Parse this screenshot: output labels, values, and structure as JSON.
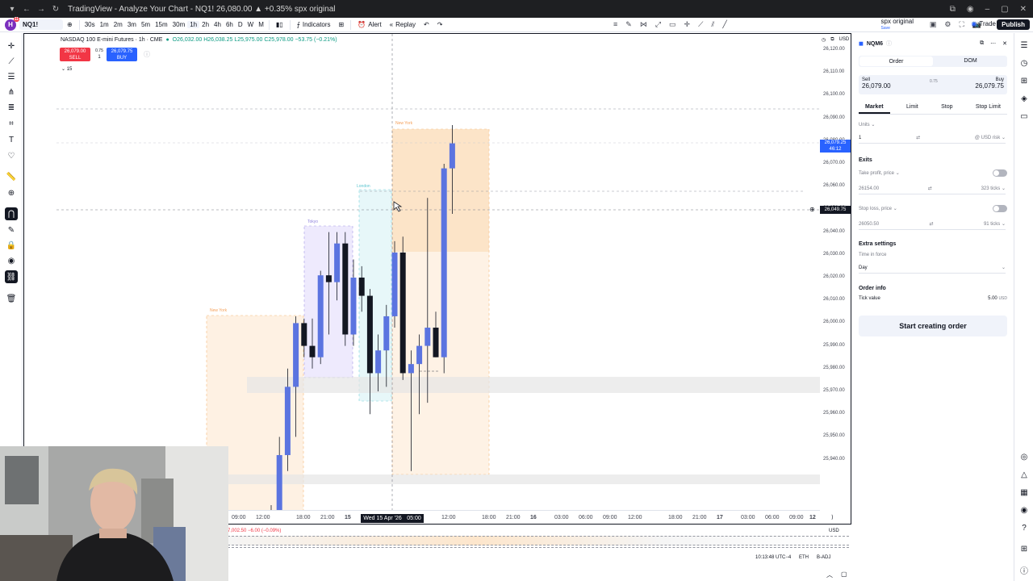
{
  "browser": {
    "tab_title": "TradingView - Analyze Your Chart - NQ1! 26,080.00 ▲ +0.35% spx original"
  },
  "toolbar": {
    "logo_letter": "H",
    "logo_badge": "11",
    "symbol": "NQ1!",
    "intervals": [
      "30s",
      "1m",
      "2m",
      "3m",
      "5m",
      "15m",
      "30m",
      "1h",
      "2h",
      "4h",
      "6h",
      "D",
      "W",
      "M"
    ],
    "indicators_label": "Indicators",
    "alert_label": "Alert",
    "replay_label": "Replay",
    "layout_name": "spx original",
    "layout_sub": "Save",
    "trade_label": "Trade",
    "publish_label": "Publish"
  },
  "legend": {
    "title": "NASDAQ 100 E-mini Futures · 1h · CME",
    "ohlc": "O26,032.00 H26,038.25 L25,975.00 C25,978.00 −53.75 (−0.21%)",
    "sell_price": "26,079.00",
    "sell_label": "SELL",
    "spread": "0.75",
    "qty": "1",
    "buy_price": "26,079.75",
    "buy_label": "BUY",
    "collapse_count": "15",
    "currency": "USD"
  },
  "price_axis": {
    "ticks": [
      "26,120.00",
      "26,110.00",
      "26,100.00",
      "26,090.00",
      "26,080.00",
      "26,070.00",
      "26,060.00",
      "26,050.00",
      "26,040.00",
      "26,030.00",
      "26,020.00",
      "26,010.00",
      "26,000.00",
      "25,990.00",
      "25,980.00",
      "25,970.00",
      "25,960.00",
      "25,950.00",
      "25,940.00"
    ],
    "current_price": "26,079.25",
    "countdown": "46:12",
    "crosshair_price": "26,049.75"
  },
  "time_axis": {
    "ticks": [
      "09:00",
      "12:00",
      "18:00",
      "21:00",
      "15",
      "12:00",
      "18:00",
      "21:00",
      "16",
      "03:00",
      "06:00",
      "09:00",
      "12:00",
      "18:00",
      "21:00",
      "17",
      "03:00",
      "06:00",
      "09:00",
      "12"
    ],
    "crosshair_date": "Wed 15 Apr '26",
    "crosshair_time": "05:00"
  },
  "sessions": {
    "tokyo": "Tokyo",
    "london": "London",
    "newyork": "New York"
  },
  "candles": [
    {
      "o": 25885,
      "h": 25920,
      "l": 25880,
      "c": 25915
    },
    {
      "o": 25915,
      "h": 25950,
      "l": 25905,
      "c": 25942
    },
    {
      "o": 25942,
      "h": 25980,
      "l": 25935,
      "c": 25972
    },
    {
      "o": 25972,
      "h": 26003,
      "l": 25950,
      "c": 26000
    },
    {
      "o": 26000,
      "h": 26002,
      "l": 25985,
      "c": 25990
    },
    {
      "o": 25990,
      "h": 26002,
      "l": 25980,
      "c": 25985
    },
    {
      "o": 25985,
      "h": 26023,
      "l": 25982,
      "c": 26021
    },
    {
      "o": 26021,
      "h": 26040,
      "l": 25995,
      "c": 26018
    },
    {
      "o": 26018,
      "h": 26040,
      "l": 26010,
      "c": 26035
    },
    {
      "o": 26035,
      "h": 26040,
      "l": 25990,
      "c": 25995
    },
    {
      "o": 25995,
      "h": 26028,
      "l": 25990,
      "c": 26020
    },
    {
      "o": 26020,
      "h": 26025,
      "l": 26005,
      "c": 26012
    },
    {
      "o": 26012,
      "h": 26015,
      "l": 25960,
      "c": 25978
    },
    {
      "o": 25978,
      "h": 25995,
      "l": 25970,
      "c": 25988
    },
    {
      "o": 25988,
      "h": 26008,
      "l": 25972,
      "c": 26003
    },
    {
      "o": 26003,
      "h": 26036,
      "l": 25998,
      "c": 26031
    },
    {
      "o": 26031,
      "h": 26038,
      "l": 25975,
      "c": 25978
    },
    {
      "o": 25978,
      "h": 25988,
      "l": 25935,
      "c": 25982
    },
    {
      "o": 25982,
      "h": 25995,
      "l": 25960,
      "c": 25990
    },
    {
      "o": 25990,
      "h": 26055,
      "l": 25965,
      "c": 25998
    },
    {
      "o": 25998,
      "h": 26005,
      "l": 25985,
      "c": 25985
    },
    {
      "o": 25985,
      "h": 26070,
      "l": 25978,
      "c": 26068
    },
    {
      "o": 26068,
      "h": 26087,
      "l": 26048,
      "c": 26079
    }
  ],
  "order_panel": {
    "symbol": "NQM6",
    "tab_order": "Order",
    "tab_dom": "DOM",
    "sell_label": "Sell",
    "sell_price": "26,079.00",
    "spread": "0.75",
    "buy_label": "Buy",
    "buy_price": "26,079.75",
    "order_types": [
      "Market",
      "Limit",
      "Stop",
      "Stop Limit"
    ],
    "units_label": "Units",
    "units_value": "1",
    "units_risk": "@ USD risk",
    "exits_label": "Exits",
    "tp_label": "Take profit, price",
    "tp_value": "26154.00",
    "tp_ticks": "323 ticks",
    "sl_label": "Stop loss, price",
    "sl_value": "26050.50",
    "sl_ticks": "91 ticks",
    "extra_label": "Extra settings",
    "tif_label": "Time in force",
    "tif_value": "Day",
    "info_label": "Order info",
    "tick_label": "Tick value",
    "tick_value": "5.00",
    "tick_currency": "USD",
    "start_button": "Start creating order"
  },
  "bottom": {
    "sub_legend": "7,002.50 −6.00 (−0.09%)",
    "currency": "USD",
    "clock": "10:13:48 UTC−4",
    "session": "ETH",
    "adj": "B-ADJ"
  }
}
